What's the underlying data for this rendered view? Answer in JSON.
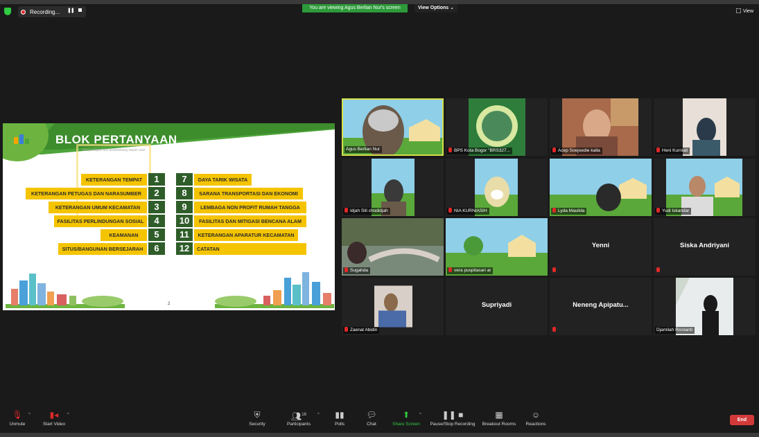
{
  "topbar": {
    "security_icon": "shield-icon",
    "recording_label": "Recording...",
    "viewing_banner": "You are viewing Agus Berlian Nur's screen",
    "view_options": "View Options ⌄",
    "view_label": "View"
  },
  "slide": {
    "title": "BLOK PERTANYAAN",
    "note": "Hanya dapat klik disbelakang sayan user",
    "page": "2",
    "left_items": [
      {
        "label": "KETERANGAN TEMPAT",
        "num": "1"
      },
      {
        "label": "KETERANGAN PETUGAS DAN NARASUMBER",
        "num": "2"
      },
      {
        "label": "KETERANGAN UMUM KECAMATAN",
        "num": "3"
      },
      {
        "label": "FASILITAS PERLINDUNGAN SOSIAL",
        "num": "4"
      },
      {
        "label": "KEAMANAN",
        "num": "5"
      },
      {
        "label": "SITUS/BANGUNAN BERSEJARAH",
        "num": "6"
      }
    ],
    "right_items": [
      {
        "label": "DAYA TARIK WISATA",
        "num": "7"
      },
      {
        "label": "SARANA TRANSPORTASI DAN EKONOMI",
        "num": "8"
      },
      {
        "label": "LEMBAGA NON PROFIT RUMAH TANGGA",
        "num": "9"
      },
      {
        "label": "FASILITAS DAN MITIGASI BENCANA ALAM",
        "num": "10"
      },
      {
        "label": "KETERANGAN APARATUR KECAMATAN",
        "num": "11"
      },
      {
        "label": "CATATAN",
        "num": "12"
      }
    ]
  },
  "participants": [
    {
      "name": "Agus Berlian Nur",
      "muted": false
    },
    {
      "name": "BPS Kota Bogor \"BRS327...",
      "muted": true
    },
    {
      "name": "Acep Soejoedie kalla",
      "muted": true
    },
    {
      "name": "Heni Kurniati",
      "muted": true
    },
    {
      "name": "Idjah Siti chodidjah",
      "muted": true
    },
    {
      "name": "NIA KURNIASIH",
      "muted": true
    },
    {
      "name": "Lyda Maulida",
      "muted": true
    },
    {
      "name": "Yudi Iskandar",
      "muted": true
    },
    {
      "name": "Sugahda",
      "muted": true
    },
    {
      "name": "vera puspitasari ar",
      "muted": true
    },
    {
      "name": "Yenni",
      "muted": true
    },
    {
      "name": "Siska Andriyani",
      "muted": true
    },
    {
      "name": "Zaenal Abidin",
      "muted": true
    },
    {
      "name": "Supriyadi",
      "muted": true
    },
    {
      "name": "Neneng Apipatu...",
      "muted": true
    },
    {
      "name": "Djamilah Risnianti",
      "muted": false
    }
  ],
  "toolbar": {
    "unmute": "Unmute",
    "start_video": "Start Video",
    "security": "Security",
    "participants": "Participants",
    "participants_count": "16",
    "polls": "Polls",
    "chat": "Chat",
    "share_screen": "Share Screen",
    "pause_recording": "Pause/Stop Recording",
    "breakout_rooms": "Breakout Rooms",
    "reactions": "Reactions",
    "end": "End"
  },
  "colors": {
    "accent_green": "#2d9a3a",
    "slide_yellow": "#f5c400",
    "number_green": "#2f5d2a",
    "end_red": "#d23a3a",
    "active_speaker": "#d4e04a"
  }
}
